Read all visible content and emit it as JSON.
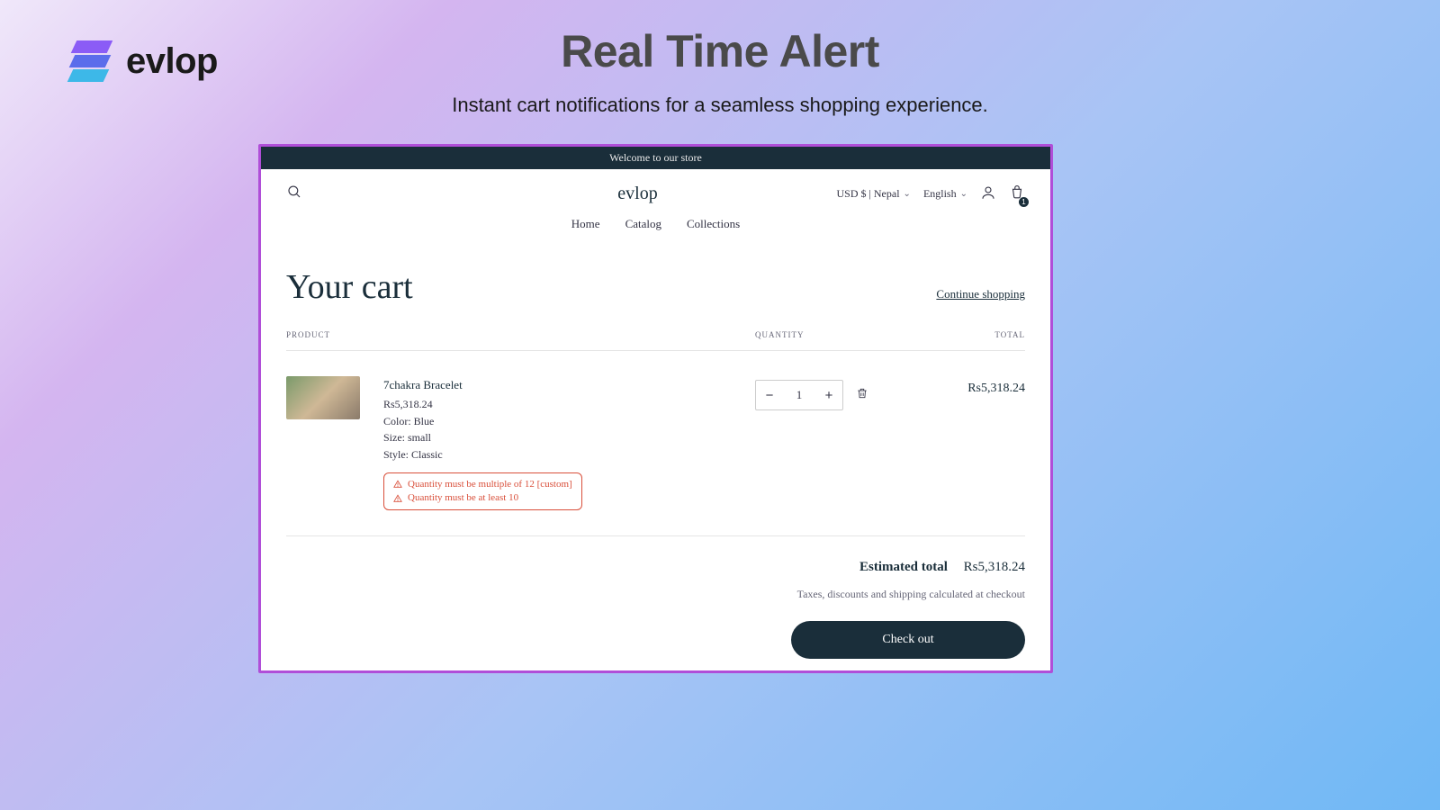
{
  "brand": {
    "name": "evlop"
  },
  "hero": {
    "title": "Real Time Alert",
    "subtitle": "Instant cart notifications for a seamless shopping experience."
  },
  "store": {
    "announcement": "Welcome to our store",
    "title": "evlop",
    "currency_selector": "USD $ | Nepal",
    "language_selector": "English",
    "cart_badge": "1",
    "nav": {
      "home": "Home",
      "catalog": "Catalog",
      "collections": "Collections"
    }
  },
  "cart": {
    "title": "Your cart",
    "continue_shopping": "Continue shopping",
    "columns": {
      "product": "PRODUCT",
      "quantity": "QUANTITY",
      "total": "TOTAL"
    },
    "item": {
      "name": "7chakra Bracelet",
      "price": "Rs5,318.24",
      "attrs": {
        "color": "Color: Blue",
        "size": "Size: small",
        "style": "Style: Classic"
      },
      "alerts": {
        "line1": "Quantity must be multiple of 12 [custom]",
        "line2": "Quantity must be at least 10"
      },
      "quantity": "1",
      "line_total": "Rs5,318.24"
    },
    "summary": {
      "estimated_label": "Estimated total",
      "estimated_value": "Rs5,318.24",
      "tax_note": "Taxes, discounts and shipping calculated at checkout",
      "checkout": "Check out"
    }
  }
}
